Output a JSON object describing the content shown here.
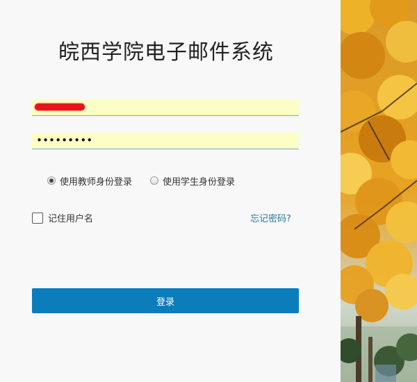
{
  "header": {
    "title": "皖西学院电子邮件系统"
  },
  "form": {
    "password_masked": "•••••••••",
    "roles": [
      {
        "label": "使用教师身份登录",
        "selected": true
      },
      {
        "label": "使用学生身份登录",
        "selected": false
      }
    ],
    "remember_label": "记住用户名",
    "remember_checked": false,
    "forgot_label": "忘记密码?",
    "submit_label": "登录"
  },
  "colors": {
    "accent": "#0b7dbd",
    "link": "#2877a8",
    "autofill_background": "#fbffc6",
    "redaction": "#e8141c"
  },
  "icons": {
    "redaction": "redaction-scribble"
  }
}
